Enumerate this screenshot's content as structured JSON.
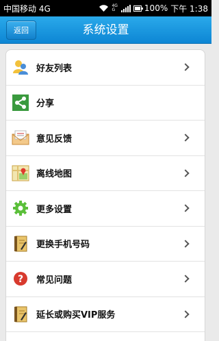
{
  "status_bar": {
    "carrier": "中国移动 4G",
    "network_small": "4G",
    "network_small2": "G",
    "battery": "100%",
    "time": "下午 1:38"
  },
  "titlebar": {
    "back_label": "返回",
    "title": "系统设置"
  },
  "menu": {
    "items": [
      {
        "label": "好友列表",
        "icon": "friends-icon",
        "chevron": true
      },
      {
        "label": "分享",
        "icon": "share-icon",
        "chevron": false
      },
      {
        "label": "意见反馈",
        "icon": "mail-icon",
        "chevron": true
      },
      {
        "label": "离线地图",
        "icon": "map-icon",
        "chevron": true
      },
      {
        "label": "更多设置",
        "icon": "gear-icon",
        "chevron": true
      },
      {
        "label": "更换手机号码",
        "icon": "notebook-icon",
        "chevron": true
      },
      {
        "label": "常见问题",
        "icon": "help-icon",
        "chevron": true
      },
      {
        "label": "延长或购买VIP服务",
        "icon": "notebook-icon",
        "chevron": true
      }
    ]
  },
  "colors": {
    "titlebar": "#1a98e0",
    "share_green": "#3a9a3e",
    "help_red": "#d83a2e"
  }
}
